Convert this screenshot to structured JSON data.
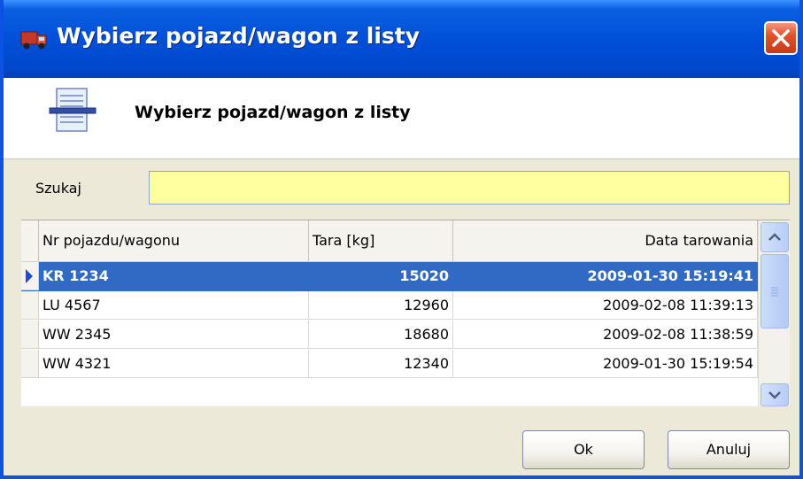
{
  "window": {
    "title": "Wybierz pojazd/wagon z listy",
    "icon": "truck-icon",
    "close_icon": "close-icon"
  },
  "header": {
    "title": "Wybierz pojazd/wagon z listy",
    "icon": "document-list-icon"
  },
  "search": {
    "label": "Szukaj",
    "value": "",
    "placeholder": ""
  },
  "table": {
    "columns": [
      "Nr pojazdu/wagonu",
      "Tara [kg]",
      "Data tarowania"
    ],
    "rows": [
      {
        "nr": "KR 1234",
        "tara": "15020",
        "data": "2009-01-30 15:19:41",
        "selected": true
      },
      {
        "nr": "LU 4567",
        "tara": "12960",
        "data": "2009-02-08 11:39:13",
        "selected": false
      },
      {
        "nr": "WW 2345",
        "tara": "18680",
        "data": "2009-02-08 11:38:59",
        "selected": false
      },
      {
        "nr": "WW 4321",
        "tara": "12340",
        "data": "2009-01-30 15:19:54",
        "selected": false
      }
    ]
  },
  "buttons": {
    "ok": "Ok",
    "cancel": "Anuluj"
  },
  "colors": {
    "titlebar": "#0050d8",
    "selection": "#316ac5",
    "search_bg": "#ffffa0"
  }
}
